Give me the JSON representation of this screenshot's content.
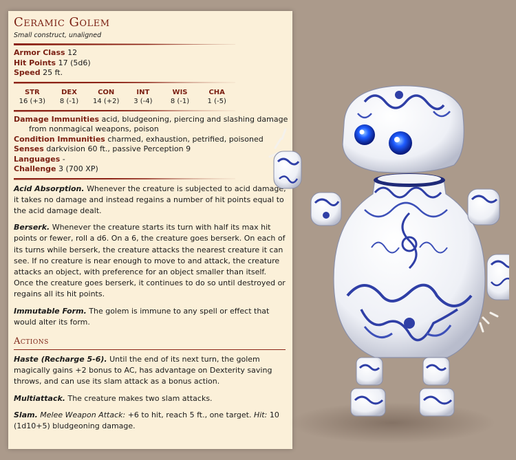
{
  "monster": {
    "name": "Ceramic Golem",
    "type": "Small construct, unaligned",
    "armor_class": {
      "label": "Armor Class",
      "value": "12"
    },
    "hit_points": {
      "label": "Hit Points",
      "value": "17 (5d6)"
    },
    "speed": {
      "label": "Speed",
      "value": "25 ft."
    },
    "abilities": [
      {
        "name": "STR",
        "value": "16 (+3)"
      },
      {
        "name": "DEX",
        "value": "8 (-1)"
      },
      {
        "name": "CON",
        "value": "14 (+2)"
      },
      {
        "name": "INT",
        "value": "3 (-4)"
      },
      {
        "name": "WIS",
        "value": "8 (-1)"
      },
      {
        "name": "CHA",
        "value": "1 (-5)"
      }
    ],
    "damage_immunities": {
      "label": "Damage Immunities",
      "value": "acid, bludgeoning, piercing and slashing damage from nonmagical weapons, poison"
    },
    "condition_immunities": {
      "label": "Condition Immunities",
      "value": "charmed, exhaustion, petrified, poisoned"
    },
    "senses": {
      "label": "Senses",
      "value": "darkvision 60 ft., passive Perception 9"
    },
    "languages": {
      "label": "Languages",
      "value": "-"
    },
    "challenge": {
      "label": "Challenge",
      "value": "3 (700 XP)"
    },
    "traits": [
      {
        "title": "Acid Absorption.",
        "text": "Whenever the creature is subjected to acid damage, it takes no damage and instead regains a number of hit points equal to the acid damage dealt."
      },
      {
        "title": "Berserk.",
        "text": "Whenever the creature starts its turn with half its max hit points or fewer, roll a d6. On a 6, the creature goes berserk. On each of its turns while berserk, the creature attacks the nearest creature it can see. If no creature is near enough to move to and attack, the creature attacks an object, with preference for an object smaller than itself. Once the creature goes berserk, it continues to do so until destroyed or regains all its hit points."
      },
      {
        "title": "Immutable Form.",
        "text": "The golem is immune to any spell or effect that would alter its form."
      }
    ],
    "actions_heading": "Actions",
    "actions": {
      "haste": {
        "title": "Haste (Recharge 5-6).",
        "text": "Until the end of its next turn, the golem magically gains +2 bonus to AC, has advantage on Dexterity saving throws, and can use its slam attack as a bonus action."
      },
      "multiattack": {
        "title": "Multiattack.",
        "text": "The creature makes two slam attacks."
      },
      "slam": {
        "title": "Slam.",
        "attack_type": "Melee Weapon Attack:",
        "attack_text": "+6 to hit, reach 5 ft., one target.",
        "hit_label": "Hit:",
        "hit_text": "10 (1d10+5) bludgeoning damage."
      }
    }
  },
  "colors": {
    "background": "#ab9a8b",
    "parchment": "#fbf0d9",
    "accent": "#7a1f12",
    "porcelain_blue": "#2f3fa6",
    "eye_blue": "#1e5cff"
  },
  "art": {
    "icon": "ceramic-golem-illustration"
  }
}
